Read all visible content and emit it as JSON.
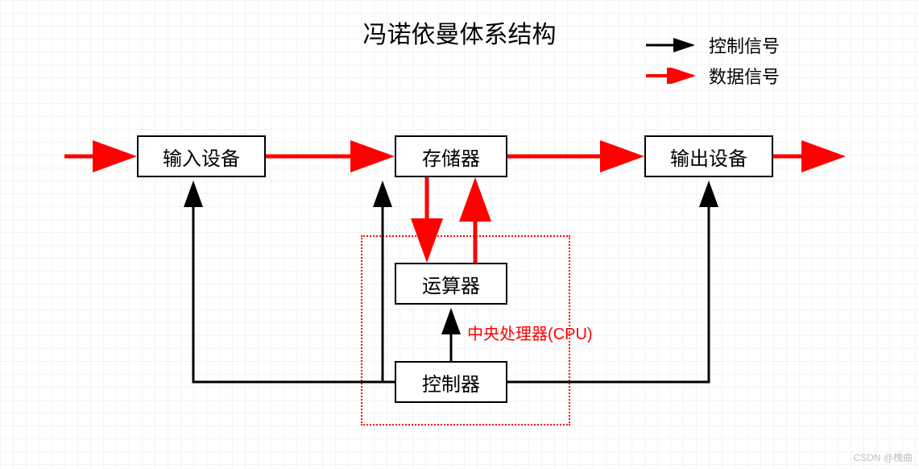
{
  "title": "冯诺依曼体系结构",
  "legend": {
    "control": "控制信号",
    "data": "数据信号"
  },
  "nodes": {
    "input": "输入设备",
    "memory": "存储器",
    "output": "输出设备",
    "alu": "运算器",
    "controller": "控制器"
  },
  "cpu_label": "中央处理器(CPU)",
  "colors": {
    "control": "#000000",
    "data": "#ff0000"
  },
  "watermark": "CSDN @槐曲",
  "chart_data": {
    "type": "diagram",
    "title": "冯诺依曼体系结构",
    "nodes": [
      {
        "id": "input",
        "label": "输入设备"
      },
      {
        "id": "memory",
        "label": "存储器"
      },
      {
        "id": "output",
        "label": "输出设备"
      },
      {
        "id": "alu",
        "label": "运算器"
      },
      {
        "id": "controller",
        "label": "控制器"
      }
    ],
    "groups": [
      {
        "id": "cpu",
        "label": "中央处理器(CPU)",
        "contains": [
          "alu",
          "controller"
        ]
      }
    ],
    "edges": [
      {
        "from": "external_in",
        "to": "input",
        "type": "data"
      },
      {
        "from": "input",
        "to": "memory",
        "type": "data"
      },
      {
        "from": "memory",
        "to": "output",
        "type": "data"
      },
      {
        "from": "output",
        "to": "external_out",
        "type": "data"
      },
      {
        "from": "memory",
        "to": "alu",
        "type": "data"
      },
      {
        "from": "alu",
        "to": "memory",
        "type": "data"
      },
      {
        "from": "controller",
        "to": "input",
        "type": "control"
      },
      {
        "from": "controller",
        "to": "memory",
        "type": "control"
      },
      {
        "from": "controller",
        "to": "alu",
        "type": "control"
      },
      {
        "from": "controller",
        "to": "output",
        "type": "control"
      }
    ],
    "legend": [
      {
        "label": "控制信号",
        "color": "#000000"
      },
      {
        "label": "数据信号",
        "color": "#ff0000"
      }
    ]
  }
}
